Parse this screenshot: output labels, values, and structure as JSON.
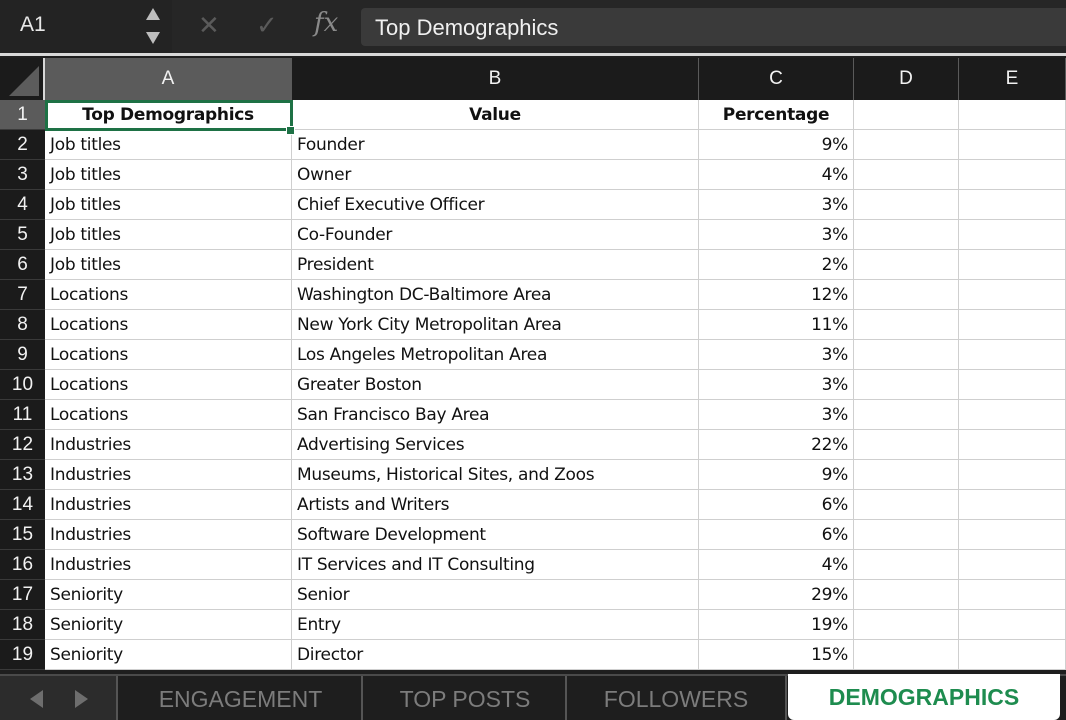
{
  "formula_bar": {
    "cell_ref": "A1",
    "cancel_icon": "✕",
    "confirm_icon": "✓",
    "fx_label": "fx",
    "content": "Top Demographics"
  },
  "columns": [
    "A",
    "B",
    "C",
    "D",
    "E"
  ],
  "selected_cell": "A1",
  "rows": [
    {
      "num": "1",
      "a": "Top Demographics",
      "b": "Value",
      "c": "Percentage"
    },
    {
      "num": "2",
      "a": "Job titles",
      "b": "Founder",
      "c": "9%"
    },
    {
      "num": "3",
      "a": "Job titles",
      "b": "Owner",
      "c": "4%"
    },
    {
      "num": "4",
      "a": "Job titles",
      "b": "Chief Executive Officer",
      "c": "3%"
    },
    {
      "num": "5",
      "a": "Job titles",
      "b": "Co-Founder",
      "c": "3%"
    },
    {
      "num": "6",
      "a": "Job titles",
      "b": "President",
      "c": "2%"
    },
    {
      "num": "7",
      "a": "Locations",
      "b": "Washington DC-Baltimore Area",
      "c": "12%"
    },
    {
      "num": "8",
      "a": "Locations",
      "b": "New York City Metropolitan Area",
      "c": "11%"
    },
    {
      "num": "9",
      "a": "Locations",
      "b": "Los Angeles Metropolitan Area",
      "c": "3%"
    },
    {
      "num": "10",
      "a": "Locations",
      "b": "Greater Boston",
      "c": "3%"
    },
    {
      "num": "11",
      "a": "Locations",
      "b": "San Francisco Bay Area",
      "c": "3%"
    },
    {
      "num": "12",
      "a": "Industries",
      "b": "Advertising Services",
      "c": "22%"
    },
    {
      "num": "13",
      "a": "Industries",
      "b": "Museums, Historical Sites, and Zoos",
      "c": "9%"
    },
    {
      "num": "14",
      "a": "Industries",
      "b": "Artists and Writers",
      "c": "6%"
    },
    {
      "num": "15",
      "a": "Industries",
      "b": "Software Development",
      "c": "6%"
    },
    {
      "num": "16",
      "a": "Industries",
      "b": "IT Services and IT Consulting",
      "c": "4%"
    },
    {
      "num": "17",
      "a": "Seniority",
      "b": "Senior",
      "c": "29%"
    },
    {
      "num": "18",
      "a": "Seniority",
      "b": "Entry",
      "c": "19%"
    },
    {
      "num": "19",
      "a": "Seniority",
      "b": "Director",
      "c": "15%"
    }
  ],
  "sheet_tabs": [
    {
      "label": "ENGAGEMENT",
      "active": false
    },
    {
      "label": "TOP POSTS",
      "active": false
    },
    {
      "label": "FOLLOWERS",
      "active": false
    },
    {
      "label": "DEMOGRAPHICS",
      "active": true
    }
  ],
  "colors": {
    "selection": "#1e7145",
    "active_tab_text": "#1e8c4f"
  }
}
